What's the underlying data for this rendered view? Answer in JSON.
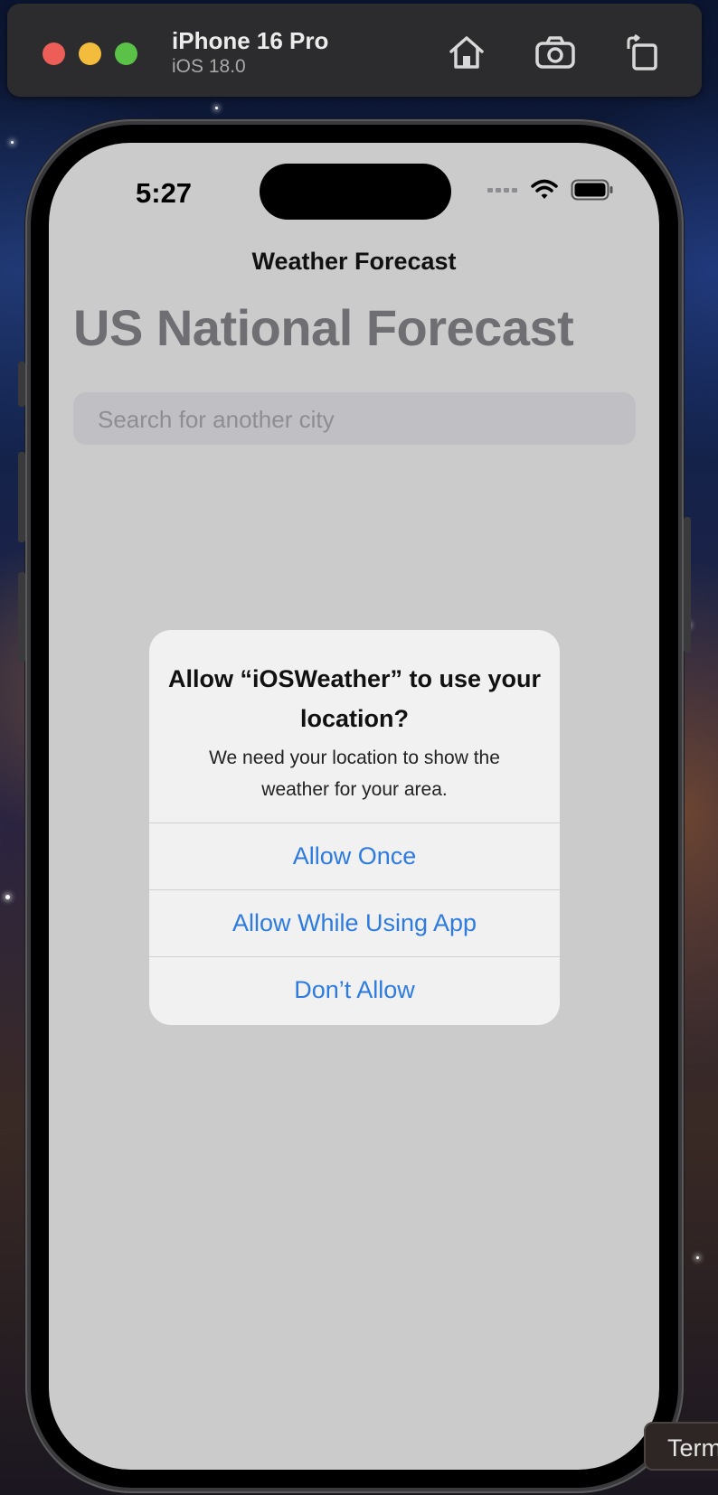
{
  "simulator": {
    "device_name": "iPhone 16 Pro",
    "os_version": "iOS 18.0",
    "buttons": {
      "home_icon": "house-icon",
      "screenshot_icon": "camera-icon",
      "rotate_icon": "rotate-icon"
    }
  },
  "status_bar": {
    "time": "5:27"
  },
  "app": {
    "nav_title": "Weather Forecast",
    "large_title": "US National Forecast",
    "search_placeholder": "Search for another city"
  },
  "alert": {
    "title": "Allow “iOSWeather” to use your location?",
    "message": "We need your location to show the weather for your area.",
    "buttons": [
      "Allow Once",
      "Allow While Using App",
      "Don’t Allow"
    ]
  },
  "dock": {
    "terminal_label": "Term"
  },
  "colors": {
    "accent": "#2d7be0",
    "screen_bg": "#cbcbcb",
    "alert_bg": "#f1f1f1",
    "title_gray": "#6f6f73"
  }
}
